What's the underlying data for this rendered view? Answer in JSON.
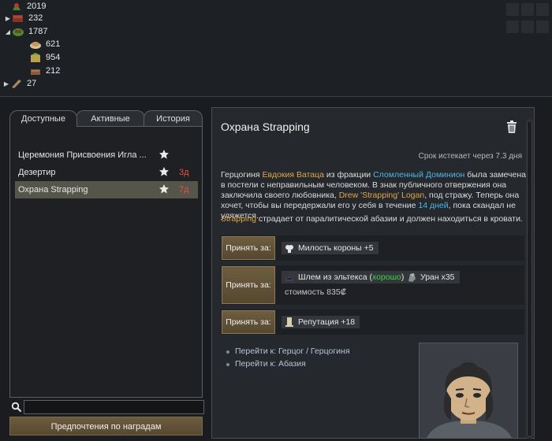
{
  "resources": {
    "rows": [
      {
        "value": "2019",
        "arrow": ""
      },
      {
        "value": "232",
        "arrow": "▶"
      },
      {
        "value": "1787",
        "arrow": "◢"
      },
      {
        "value": "621",
        "arrow": ""
      },
      {
        "value": "954",
        "arrow": ""
      },
      {
        "value": "212",
        "arrow": ""
      },
      {
        "value": "27",
        "arrow": "▶"
      }
    ]
  },
  "tabs": [
    {
      "label": "Доступные"
    },
    {
      "label": "Активные"
    },
    {
      "label": "История"
    }
  ],
  "quests": [
    {
      "name": "Церемония Присвоения Игла ...",
      "days": ""
    },
    {
      "name": "Дезертир",
      "days": "3д"
    },
    {
      "name": "Охрана Strapping",
      "days": "7д"
    }
  ],
  "search": {
    "value": ""
  },
  "preferences_button": "Предпочтения по наградам",
  "detail": {
    "title": "Охрана Strapping",
    "expires": "Срок истекает через 7.3 дня",
    "desc": {
      "p1": "Герцогиня ",
      "noble": "Евдокия Ватаца",
      "p2": " из фракции ",
      "faction": "Сломленный Доминион",
      "p3": " была замечена в постели с неправильным человеком. В знак публичного отвержения она заключила своего любовника, ",
      "lover": "Drew 'Strapping' Logan",
      "p4": ", под стражу. Теперь она хочет, чтобы вы передержали его у себя в течение ",
      "duration": "14 дней",
      "p5": ", пока скандал не уляжется."
    },
    "desc2": {
      "name": "Strapping",
      "rest": " страдает от паралитической абазии и должен находиться в кровати."
    },
    "rewards": [
      {
        "accept": "Принять за:",
        "items": [
          {
            "label": "Милость короны +5",
            "icon": "crown-favor-icon"
          }
        ]
      },
      {
        "accept": "Принять за:",
        "items": [
          {
            "label_pre": "Шлем из эльтекса (",
            "label_quality": "хорошо",
            "label_post": ")",
            "icon": "eltex-helmet-icon"
          },
          {
            "label": "Уран x35",
            "icon": "uranium-icon"
          }
        ],
        "cost": "стоимость 835₡"
      },
      {
        "accept": "Принять за:",
        "items": [
          {
            "label": "Репутация +18",
            "icon": "reputation-icon"
          }
        ]
      }
    ],
    "links": [
      {
        "label": "Перейти к: Герцог / Герцогиня"
      },
      {
        "label": "Перейти к: Абазия"
      }
    ]
  },
  "colors": {
    "accent_link": "#4fb6e8",
    "name_highlight": "#e0a64a",
    "days_red": "#e8503c",
    "quality_good": "#3ed64a"
  }
}
